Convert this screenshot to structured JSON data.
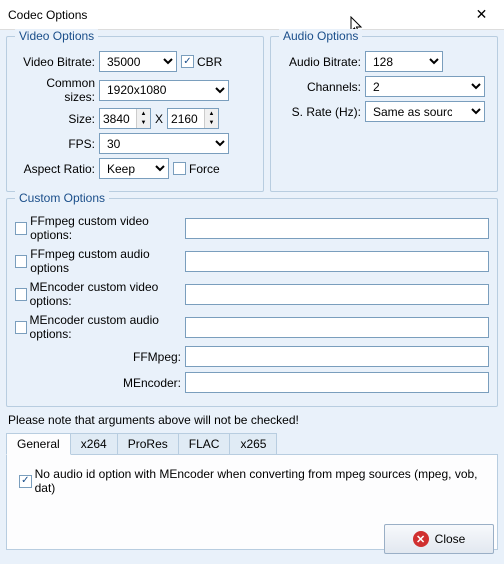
{
  "window": {
    "title": "Codec Options"
  },
  "video": {
    "group": "Video Options",
    "bitrate_label": "Video Bitrate:",
    "bitrate": "35000",
    "cbr": "CBR",
    "common_sizes_label": "Common sizes:",
    "common_sizes": "1920x1080",
    "size_label": "Size:",
    "width": "3840",
    "height": "2160",
    "x": "X",
    "fps_label": "FPS:",
    "fps": "30",
    "aspect_label": "Aspect Ratio:",
    "aspect": "Keep",
    "force": "Force"
  },
  "audio": {
    "group": "Audio Options",
    "bitrate_label": "Audio Bitrate:",
    "bitrate": "128",
    "channels_label": "Channels:",
    "channels": "2",
    "srate_label": "S. Rate (Hz):",
    "srate": "Same as source"
  },
  "custom": {
    "group": "Custom Options",
    "ff_video": "FFmpeg custom video options:",
    "ff_audio": "FFmpeg custom audio options",
    "me_video": "MEncoder custom video options:",
    "me_audio": "MEncoder custom audio options:",
    "ffmpeg_label": "FFMpeg:",
    "mencoder_label": "MEncoder:"
  },
  "note": "Please note that arguments above will not be checked!",
  "tabs": {
    "general": "General",
    "x264": "x264",
    "prores": "ProRes",
    "flac": "FLAC",
    "x265": "x265",
    "option": "No audio id option with MEncoder when converting from mpeg sources (mpeg, vob, dat)"
  },
  "footer": {
    "close": "Close"
  }
}
